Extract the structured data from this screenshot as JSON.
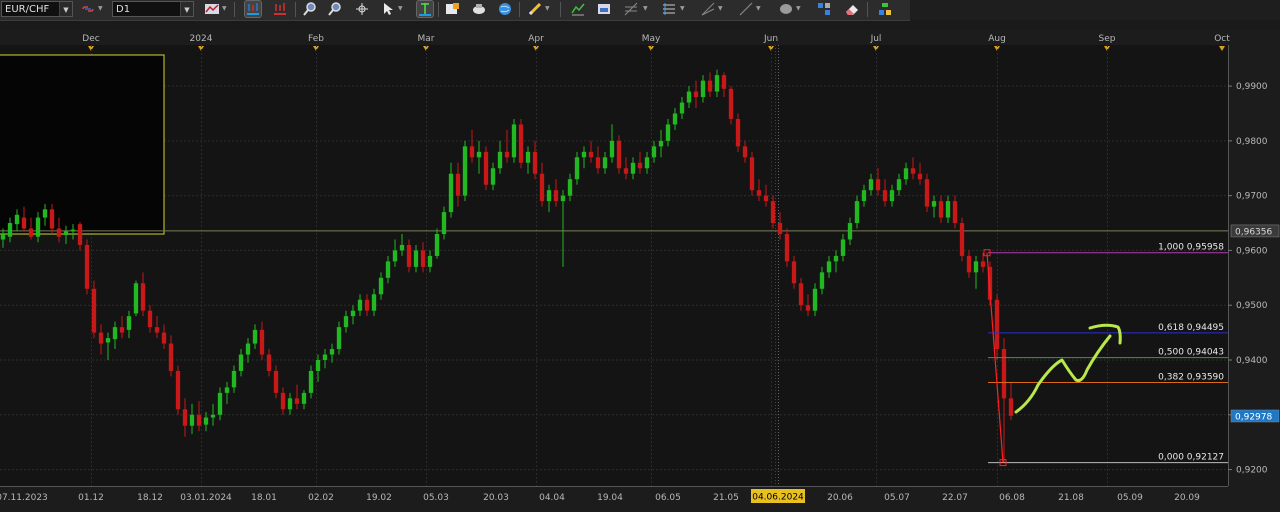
{
  "toolbar": {
    "symbol": "EUR/CHF",
    "timeframe": "D1",
    "icons": [
      "link-icon",
      "chart-type-icon",
      "bar-chart-icon",
      "ohlc-chart-icon",
      "zoom-in-icon",
      "zoom-out-icon",
      "crosshair-icon",
      "cursor-icon",
      "line-tool-icon",
      "add-indicator-icon",
      "candle-settings-icon",
      "globe-icon",
      "pen-icon",
      "trend-lines-icon",
      "template-icon",
      "fibonacci-icon",
      "channel-icon",
      "ray-icon",
      "trend-line-icon",
      "shapes-icon",
      "objects-icon",
      "eraser-icon",
      "properties-icon"
    ]
  },
  "chart_data": {
    "type": "candlestick",
    "symbol": "EUR/CHF",
    "timeframe": "D1",
    "x_top_labels": [
      "Dec",
      "2024",
      "Feb",
      "Mar",
      "Apr",
      "May",
      "Jun",
      "Jul",
      "Aug",
      "Sep",
      "Oct"
    ],
    "x_bottom_labels": [
      "07.11.2023",
      "01.12",
      "18.12",
      "03.01.2024",
      "18.01",
      "02.02",
      "19.02",
      "05.03",
      "20.03",
      "04.04",
      "19.04",
      "06.05",
      "21.05",
      "04.06.2024",
      "20.06",
      "05.07",
      "22.07",
      "06.08",
      "21.08",
      "05.09",
      "20.09"
    ],
    "crosshair_date": "04.06.2024",
    "y_ticks": [
      "0,9900",
      "0,9800",
      "0,9700",
      "0,9600",
      "0,9500",
      "0,9400",
      "0,9300",
      "0,9200"
    ],
    "ylim": [
      0.917,
      0.9975
    ],
    "y_labels": [
      {
        "label": "0,96356",
        "value": 0.96356,
        "color": "#d8d8d8",
        "bg": "#3a3a3a"
      },
      {
        "label": "0,92978",
        "value": 0.92978,
        "color": "#ffffff",
        "bg": "#1e78c8"
      }
    ],
    "horizontal_line": {
      "value": 0.96356,
      "color": "#7a7f58"
    },
    "fibonacci": [
      {
        "label": "1,000 0,95958",
        "value": 0.95958,
        "color": "#b03ab0"
      },
      {
        "label": "0,618 0,94495",
        "value": 0.94495,
        "color": "#2a2ad8"
      },
      {
        "label": "0,500 0,94043",
        "value": 0.94043,
        "color": "#2aa82a"
      },
      {
        "label": "0,382 0,93590",
        "value": 0.9359,
        "color": "#d86a1a"
      },
      {
        "label": "0,000 0,92127",
        "value": 0.92127,
        "color": "#bbbbbb"
      }
    ],
    "colors": {
      "up": "#22b822",
      "down": "#c81818",
      "arrow": "#b8e84a",
      "fib_leg": "#ff2020",
      "grid": "#2c2c2c",
      "ref_line": "#7a7f58"
    },
    "candles": [
      {
        "o": 0.962,
        "h": 0.964,
        "l": 0.9605,
        "c": 0.963
      },
      {
        "o": 0.9625,
        "h": 0.966,
        "l": 0.9615,
        "c": 0.965
      },
      {
        "o": 0.9648,
        "h": 0.9675,
        "l": 0.9635,
        "c": 0.9665
      },
      {
        "o": 0.966,
        "h": 0.968,
        "l": 0.9635,
        "c": 0.964
      },
      {
        "o": 0.964,
        "h": 0.966,
        "l": 0.962,
        "c": 0.9625
      },
      {
        "o": 0.9625,
        "h": 0.967,
        "l": 0.9615,
        "c": 0.966
      },
      {
        "o": 0.966,
        "h": 0.9685,
        "l": 0.9645,
        "c": 0.9675
      },
      {
        "o": 0.9675,
        "h": 0.9685,
        "l": 0.963,
        "c": 0.964
      },
      {
        "o": 0.964,
        "h": 0.966,
        "l": 0.9615,
        "c": 0.9625
      },
      {
        "o": 0.9628,
        "h": 0.9645,
        "l": 0.9612,
        "c": 0.9635
      },
      {
        "o": 0.9635,
        "h": 0.9648,
        "l": 0.962,
        "c": 0.9638
      },
      {
        "o": 0.9648,
        "h": 0.9652,
        "l": 0.96,
        "c": 0.961
      },
      {
        "o": 0.961,
        "h": 0.962,
        "l": 0.952,
        "c": 0.953
      },
      {
        "o": 0.953,
        "h": 0.9545,
        "l": 0.944,
        "c": 0.945
      },
      {
        "o": 0.945,
        "h": 0.9465,
        "l": 0.941,
        "c": 0.943
      },
      {
        "o": 0.9432,
        "h": 0.945,
        "l": 0.94,
        "c": 0.944
      },
      {
        "o": 0.9438,
        "h": 0.947,
        "l": 0.942,
        "c": 0.946
      },
      {
        "o": 0.946,
        "h": 0.948,
        "l": 0.944,
        "c": 0.945
      },
      {
        "o": 0.9455,
        "h": 0.949,
        "l": 0.944,
        "c": 0.948
      },
      {
        "o": 0.9485,
        "h": 0.9545,
        "l": 0.948,
        "c": 0.954
      },
      {
        "o": 0.954,
        "h": 0.956,
        "l": 0.948,
        "c": 0.949
      },
      {
        "o": 0.949,
        "h": 0.95,
        "l": 0.945,
        "c": 0.946
      },
      {
        "o": 0.946,
        "h": 0.948,
        "l": 0.944,
        "c": 0.945
      },
      {
        "o": 0.945,
        "h": 0.9465,
        "l": 0.942,
        "c": 0.943
      },
      {
        "o": 0.943,
        "h": 0.9445,
        "l": 0.937,
        "c": 0.938
      },
      {
        "o": 0.938,
        "h": 0.939,
        "l": 0.93,
        "c": 0.931
      },
      {
        "o": 0.931,
        "h": 0.933,
        "l": 0.926,
        "c": 0.928
      },
      {
        "o": 0.928,
        "h": 0.932,
        "l": 0.9265,
        "c": 0.93
      },
      {
        "o": 0.93,
        "h": 0.9325,
        "l": 0.927,
        "c": 0.928
      },
      {
        "o": 0.9282,
        "h": 0.9305,
        "l": 0.927,
        "c": 0.9295
      },
      {
        "o": 0.9295,
        "h": 0.932,
        "l": 0.928,
        "c": 0.93
      },
      {
        "o": 0.93,
        "h": 0.935,
        "l": 0.929,
        "c": 0.934
      },
      {
        "o": 0.934,
        "h": 0.936,
        "l": 0.932,
        "c": 0.935
      },
      {
        "o": 0.935,
        "h": 0.939,
        "l": 0.934,
        "c": 0.938
      },
      {
        "o": 0.938,
        "h": 0.942,
        "l": 0.937,
        "c": 0.941
      },
      {
        "o": 0.941,
        "h": 0.944,
        "l": 0.9395,
        "c": 0.943
      },
      {
        "o": 0.943,
        "h": 0.9465,
        "l": 0.942,
        "c": 0.9455
      },
      {
        "o": 0.9455,
        "h": 0.947,
        "l": 0.94,
        "c": 0.941
      },
      {
        "o": 0.941,
        "h": 0.942,
        "l": 0.937,
        "c": 0.938
      },
      {
        "o": 0.938,
        "h": 0.939,
        "l": 0.933,
        "c": 0.934
      },
      {
        "o": 0.934,
        "h": 0.935,
        "l": 0.93,
        "c": 0.931
      },
      {
        "o": 0.931,
        "h": 0.934,
        "l": 0.93,
        "c": 0.933
      },
      {
        "o": 0.933,
        "h": 0.9355,
        "l": 0.931,
        "c": 0.932
      },
      {
        "o": 0.932,
        "h": 0.9345,
        "l": 0.931,
        "c": 0.934
      },
      {
        "o": 0.934,
        "h": 0.939,
        "l": 0.933,
        "c": 0.938
      },
      {
        "o": 0.938,
        "h": 0.941,
        "l": 0.936,
        "c": 0.94
      },
      {
        "o": 0.94,
        "h": 0.942,
        "l": 0.9385,
        "c": 0.941
      },
      {
        "o": 0.941,
        "h": 0.943,
        "l": 0.9395,
        "c": 0.942
      },
      {
        "o": 0.942,
        "h": 0.947,
        "l": 0.941,
        "c": 0.946
      },
      {
        "o": 0.946,
        "h": 0.949,
        "l": 0.945,
        "c": 0.948
      },
      {
        "o": 0.948,
        "h": 0.95,
        "l": 0.9465,
        "c": 0.949
      },
      {
        "o": 0.949,
        "h": 0.952,
        "l": 0.948,
        "c": 0.951
      },
      {
        "o": 0.951,
        "h": 0.952,
        "l": 0.948,
        "c": 0.949
      },
      {
        "o": 0.949,
        "h": 0.953,
        "l": 0.948,
        "c": 0.952
      },
      {
        "o": 0.952,
        "h": 0.956,
        "l": 0.951,
        "c": 0.955
      },
      {
        "o": 0.955,
        "h": 0.959,
        "l": 0.954,
        "c": 0.958
      },
      {
        "o": 0.958,
        "h": 0.962,
        "l": 0.957,
        "c": 0.96
      },
      {
        "o": 0.96,
        "h": 0.963,
        "l": 0.959,
        "c": 0.961
      },
      {
        "o": 0.961,
        "h": 0.962,
        "l": 0.956,
        "c": 0.957
      },
      {
        "o": 0.957,
        "h": 0.961,
        "l": 0.956,
        "c": 0.96
      },
      {
        "o": 0.96,
        "h": 0.9615,
        "l": 0.956,
        "c": 0.957
      },
      {
        "o": 0.957,
        "h": 0.96,
        "l": 0.956,
        "c": 0.959
      },
      {
        "o": 0.959,
        "h": 0.964,
        "l": 0.9585,
        "c": 0.963
      },
      {
        "o": 0.963,
        "h": 0.968,
        "l": 0.962,
        "c": 0.967
      },
      {
        "o": 0.967,
        "h": 0.976,
        "l": 0.966,
        "c": 0.974
      },
      {
        "o": 0.974,
        "h": 0.976,
        "l": 0.968,
        "c": 0.97
      },
      {
        "o": 0.97,
        "h": 0.98,
        "l": 0.969,
        "c": 0.979
      },
      {
        "o": 0.979,
        "h": 0.982,
        "l": 0.976,
        "c": 0.977
      },
      {
        "o": 0.977,
        "h": 0.98,
        "l": 0.974,
        "c": 0.978
      },
      {
        "o": 0.978,
        "h": 0.979,
        "l": 0.971,
        "c": 0.972
      },
      {
        "o": 0.972,
        "h": 0.976,
        "l": 0.971,
        "c": 0.975
      },
      {
        "o": 0.975,
        "h": 0.98,
        "l": 0.974,
        "c": 0.978
      },
      {
        "o": 0.978,
        "h": 0.982,
        "l": 0.976,
        "c": 0.977
      },
      {
        "o": 0.977,
        "h": 0.984,
        "l": 0.976,
        "c": 0.983
      },
      {
        "o": 0.983,
        "h": 0.984,
        "l": 0.975,
        "c": 0.976
      },
      {
        "o": 0.976,
        "h": 0.979,
        "l": 0.974,
        "c": 0.978
      },
      {
        "o": 0.978,
        "h": 0.98,
        "l": 0.973,
        "c": 0.974
      },
      {
        "o": 0.974,
        "h": 0.976,
        "l": 0.968,
        "c": 0.969
      },
      {
        "o": 0.969,
        "h": 0.972,
        "l": 0.967,
        "c": 0.971
      },
      {
        "o": 0.971,
        "h": 0.973,
        "l": 0.968,
        "c": 0.969
      },
      {
        "o": 0.969,
        "h": 0.971,
        "l": 0.957,
        "c": 0.97
      },
      {
        "o": 0.97,
        "h": 0.974,
        "l": 0.969,
        "c": 0.973
      },
      {
        "o": 0.973,
        "h": 0.978,
        "l": 0.972,
        "c": 0.977
      },
      {
        "o": 0.977,
        "h": 0.979,
        "l": 0.975,
        "c": 0.978
      },
      {
        "o": 0.978,
        "h": 0.98,
        "l": 0.976,
        "c": 0.977
      },
      {
        "o": 0.977,
        "h": 0.979,
        "l": 0.974,
        "c": 0.975
      },
      {
        "o": 0.975,
        "h": 0.978,
        "l": 0.974,
        "c": 0.977
      },
      {
        "o": 0.977,
        "h": 0.983,
        "l": 0.976,
        "c": 0.98
      },
      {
        "o": 0.98,
        "h": 0.981,
        "l": 0.974,
        "c": 0.975
      },
      {
        "o": 0.975,
        "h": 0.977,
        "l": 0.973,
        "c": 0.974
      },
      {
        "o": 0.974,
        "h": 0.977,
        "l": 0.973,
        "c": 0.976
      },
      {
        "o": 0.976,
        "h": 0.978,
        "l": 0.974,
        "c": 0.975
      },
      {
        "o": 0.975,
        "h": 0.978,
        "l": 0.974,
        "c": 0.977
      },
      {
        "o": 0.977,
        "h": 0.98,
        "l": 0.976,
        "c": 0.979
      },
      {
        "o": 0.979,
        "h": 0.982,
        "l": 0.977,
        "c": 0.98
      },
      {
        "o": 0.98,
        "h": 0.984,
        "l": 0.979,
        "c": 0.983
      },
      {
        "o": 0.983,
        "h": 0.986,
        "l": 0.982,
        "c": 0.985
      },
      {
        "o": 0.985,
        "h": 0.988,
        "l": 0.984,
        "c": 0.987
      },
      {
        "o": 0.987,
        "h": 0.99,
        "l": 0.986,
        "c": 0.989
      },
      {
        "o": 0.989,
        "h": 0.991,
        "l": 0.986,
        "c": 0.988
      },
      {
        "o": 0.988,
        "h": 0.992,
        "l": 0.987,
        "c": 0.991
      },
      {
        "o": 0.991,
        "h": 0.9925,
        "l": 0.988,
        "c": 0.989
      },
      {
        "o": 0.989,
        "h": 0.993,
        "l": 0.988,
        "c": 0.992
      },
      {
        "o": 0.992,
        "h": 0.9925,
        "l": 0.988,
        "c": 0.9895
      },
      {
        "o": 0.9895,
        "h": 0.99,
        "l": 0.983,
        "c": 0.984
      },
      {
        "o": 0.984,
        "h": 0.985,
        "l": 0.978,
        "c": 0.979
      },
      {
        "o": 0.979,
        "h": 0.98,
        "l": 0.976,
        "c": 0.977
      },
      {
        "o": 0.977,
        "h": 0.978,
        "l": 0.97,
        "c": 0.971
      },
      {
        "o": 0.971,
        "h": 0.973,
        "l": 0.969,
        "c": 0.97
      },
      {
        "o": 0.97,
        "h": 0.972,
        "l": 0.968,
        "c": 0.969
      },
      {
        "o": 0.969,
        "h": 0.97,
        "l": 0.964,
        "c": 0.965
      },
      {
        "o": 0.965,
        "h": 0.967,
        "l": 0.962,
        "c": 0.963
      },
      {
        "o": 0.963,
        "h": 0.964,
        "l": 0.957,
        "c": 0.958
      },
      {
        "o": 0.958,
        "h": 0.959,
        "l": 0.953,
        "c": 0.954
      },
      {
        "o": 0.954,
        "h": 0.955,
        "l": 0.949,
        "c": 0.95
      },
      {
        "o": 0.95,
        "h": 0.952,
        "l": 0.948,
        "c": 0.949
      },
      {
        "o": 0.949,
        "h": 0.954,
        "l": 0.948,
        "c": 0.953
      },
      {
        "o": 0.953,
        "h": 0.957,
        "l": 0.952,
        "c": 0.956
      },
      {
        "o": 0.956,
        "h": 0.959,
        "l": 0.955,
        "c": 0.958
      },
      {
        "o": 0.958,
        "h": 0.96,
        "l": 0.956,
        "c": 0.959
      },
      {
        "o": 0.959,
        "h": 0.963,
        "l": 0.958,
        "c": 0.962
      },
      {
        "o": 0.962,
        "h": 0.966,
        "l": 0.961,
        "c": 0.965
      },
      {
        "o": 0.965,
        "h": 0.97,
        "l": 0.964,
        "c": 0.969
      },
      {
        "o": 0.969,
        "h": 0.972,
        "l": 0.968,
        "c": 0.971
      },
      {
        "o": 0.971,
        "h": 0.974,
        "l": 0.97,
        "c": 0.973
      },
      {
        "o": 0.973,
        "h": 0.975,
        "l": 0.97,
        "c": 0.971
      },
      {
        "o": 0.971,
        "h": 0.973,
        "l": 0.968,
        "c": 0.969
      },
      {
        "o": 0.969,
        "h": 0.972,
        "l": 0.968,
        "c": 0.971
      },
      {
        "o": 0.971,
        "h": 0.974,
        "l": 0.97,
        "c": 0.973
      },
      {
        "o": 0.973,
        "h": 0.976,
        "l": 0.972,
        "c": 0.975
      },
      {
        "o": 0.975,
        "h": 0.977,
        "l": 0.973,
        "c": 0.974
      },
      {
        "o": 0.974,
        "h": 0.976,
        "l": 0.972,
        "c": 0.973
      },
      {
        "o": 0.973,
        "h": 0.974,
        "l": 0.967,
        "c": 0.968
      },
      {
        "o": 0.968,
        "h": 0.97,
        "l": 0.966,
        "c": 0.969
      },
      {
        "o": 0.969,
        "h": 0.97,
        "l": 0.965,
        "c": 0.966
      },
      {
        "o": 0.966,
        "h": 0.97,
        "l": 0.965,
        "c": 0.969
      },
      {
        "o": 0.969,
        "h": 0.97,
        "l": 0.964,
        "c": 0.965
      },
      {
        "o": 0.965,
        "h": 0.966,
        "l": 0.958,
        "c": 0.959
      },
      {
        "o": 0.959,
        "h": 0.96,
        "l": 0.955,
        "c": 0.956
      },
      {
        "o": 0.956,
        "h": 0.959,
        "l": 0.953,
        "c": 0.958
      },
      {
        "o": 0.958,
        "h": 0.9596,
        "l": 0.956,
        "c": 0.957
      },
      {
        "o": 0.957,
        "h": 0.958,
        "l": 0.95,
        "c": 0.951
      },
      {
        "o": 0.951,
        "h": 0.952,
        "l": 0.94,
        "c": 0.942
      },
      {
        "o": 0.942,
        "h": 0.944,
        "l": 0.9213,
        "c": 0.933
      },
      {
        "o": 0.933,
        "h": 0.936,
        "l": 0.929,
        "c": 0.9298
      }
    ]
  }
}
